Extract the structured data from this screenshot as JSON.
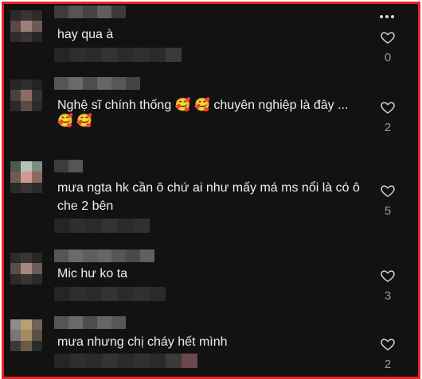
{
  "comments": [
    {
      "text": "hay qua à",
      "likes": "0",
      "emoji": ""
    },
    {
      "text": "Nghệ sĩ chính thống 🥰 🥰 chuyên nghiệp là đây ...",
      "text2": "🥰 🥰",
      "likes": "2"
    },
    {
      "text": "mưa ngta hk cần ô chứ ai như mấy má ms nổi là có ô",
      "text2": "che 2 bên",
      "likes": "5"
    },
    {
      "text": "Mic hư ko ta",
      "likes": "3"
    },
    {
      "text": "mưa nhưng chị cháy hết mình",
      "likes": "2"
    }
  ],
  "icons": {
    "more": "more-dots-icon",
    "like": "heart-outline-icon"
  }
}
